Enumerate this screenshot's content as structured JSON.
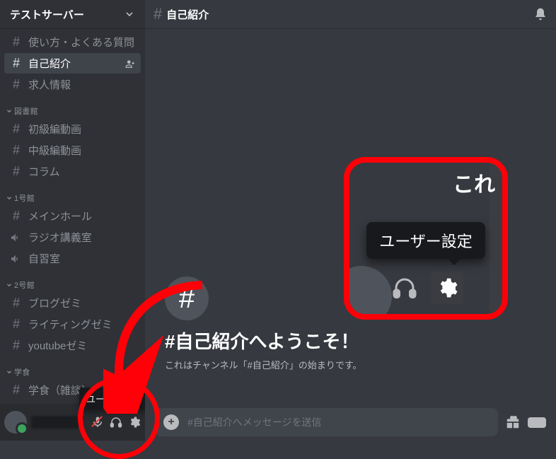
{
  "server": {
    "name": "テストサーバー"
  },
  "header": {
    "channel_hash": "#",
    "channel_name": "自己紹介"
  },
  "categories": [
    {
      "name": "",
      "channels": [
        {
          "type": "text",
          "label": "使い方・よくある質問"
        },
        {
          "type": "text",
          "label": "自己紹介",
          "selected": true,
          "invite": true
        },
        {
          "type": "text",
          "label": "求人情報"
        }
      ]
    },
    {
      "name": "図書館",
      "channels": [
        {
          "type": "text",
          "label": "初級編動画"
        },
        {
          "type": "text",
          "label": "中級編動画"
        },
        {
          "type": "text",
          "label": "コラム"
        }
      ]
    },
    {
      "name": "1号館",
      "channels": [
        {
          "type": "text",
          "label": "メインホール"
        },
        {
          "type": "voice",
          "label": "ラジオ講義室"
        },
        {
          "type": "voice",
          "label": "自習室"
        }
      ]
    },
    {
      "name": "2号館",
      "channels": [
        {
          "type": "text",
          "label": "ブログゼミ"
        },
        {
          "type": "text",
          "label": "ライティングゼミ"
        },
        {
          "type": "text",
          "label": "youtubeゼミ"
        }
      ]
    },
    {
      "name": "学食",
      "channels": [
        {
          "type": "text",
          "label": "学食（雑談）"
        }
      ]
    }
  ],
  "tooltip": {
    "user_settings": "ユーザー設定"
  },
  "zoom": {
    "cuttext": "こ⁣れ",
    "tooltip": "ユーザー設定"
  },
  "welcome": {
    "title": "#自己紹介へようこそ！",
    "subtitle": "これはチャンネル「#自己紹介」の始まりです。"
  },
  "composer": {
    "placeholder": "#自己紹介へメッセージを送信",
    "gif_label": "GIF"
  },
  "icons": {
    "hash": "#",
    "chevron_down": "⌄",
    "chevron_cat": "⌄",
    "invite": "person-plus",
    "bell": "bell",
    "mic": "mic",
    "headphones": "headphones",
    "gear": "gear",
    "gift": "gift",
    "plus": "+"
  },
  "colors": {
    "annotation_red": "#ff0008"
  }
}
